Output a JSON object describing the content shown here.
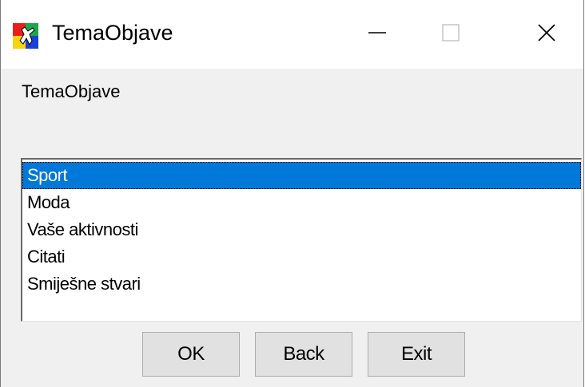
{
  "window": {
    "title": "TemaObjave",
    "icon": "app-icon",
    "controls": {
      "minimize_icon": "minimize-icon",
      "maximize_icon": "maximize-icon",
      "close_icon": "close-icon"
    }
  },
  "dialog": {
    "label": "TemaObjave",
    "list": {
      "items": [
        "Sport",
        "Moda",
        "Vaše aktivnosti",
        "Citati",
        "Smiješne stvari"
      ],
      "selected": "Sport"
    },
    "buttons": {
      "ok": "OK",
      "back": "Back",
      "exit": "Exit"
    }
  },
  "colors": {
    "selection": "#0078d7",
    "button_face": "#e1e1e1",
    "dialog_background": "#f0f0f0"
  }
}
